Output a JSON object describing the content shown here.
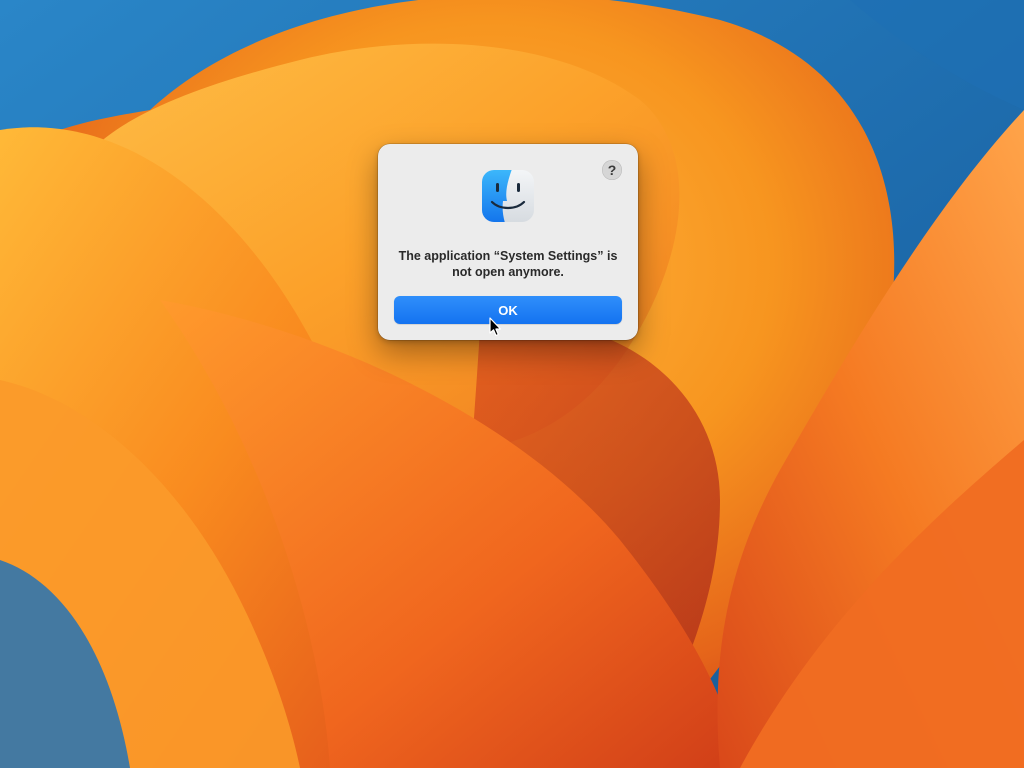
{
  "dialog": {
    "app_icon": "finder-icon",
    "help_label": "?",
    "message": "The application “System Settings” is not open anymore.",
    "ok_label": "OK"
  },
  "desktop": {
    "wallpaper": "macos-ventura-wallpaper"
  },
  "colors": {
    "accent": "#1a7cf5",
    "dialog_bg": "#ececec",
    "wallpaper_blue": "#1f6fb0",
    "wallpaper_orange": "#f58a1f"
  }
}
